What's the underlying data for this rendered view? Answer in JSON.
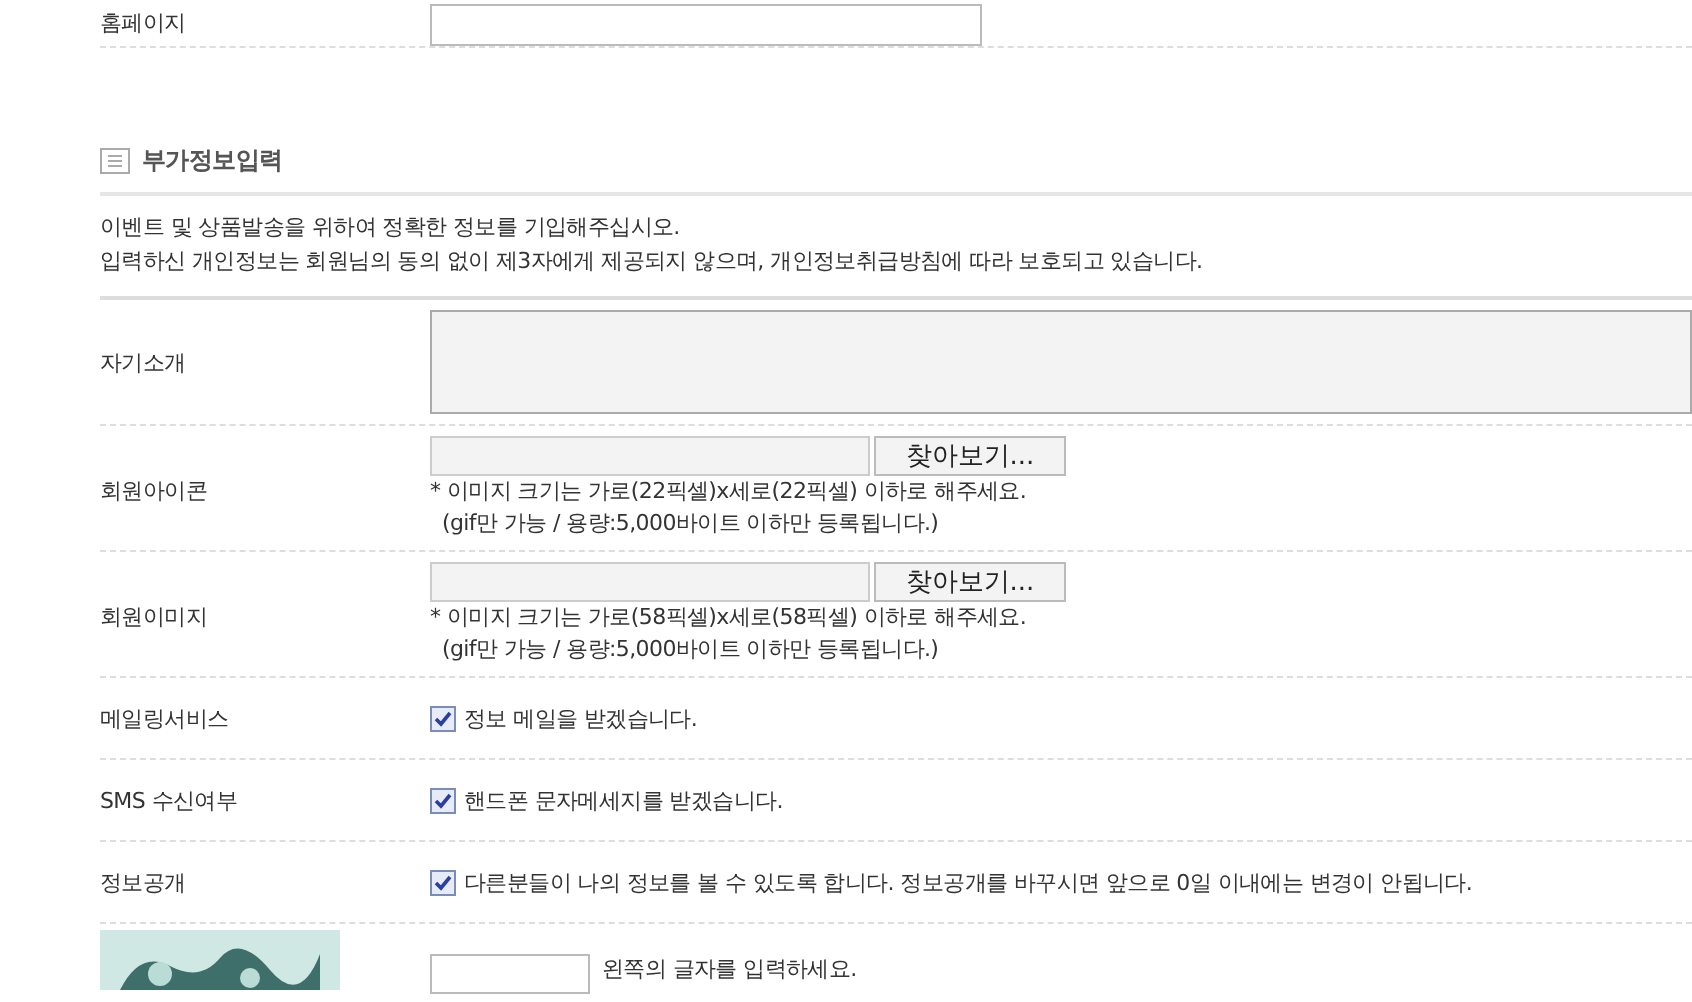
{
  "top_row": {
    "label": "홈페이지"
  },
  "section": {
    "title": "부가정보입력",
    "intro": [
      "이벤트 및 상품발송을 위하여 정확한 정보를 기입해주십시오.",
      "입력하신 개인정보는 회원님의 동의 없이 제3자에게 제공되지 않으며, 개인정보취급방침에 따라 보호되고 있습니다."
    ]
  },
  "rows": [
    {
      "kind": "textarea",
      "label": "자기소개"
    },
    {
      "kind": "file",
      "label": "회원아이콘",
      "button": "찾아보기...",
      "notes": [
        "* 이미지 크기는 가로(22픽셀)x세로(22픽셀) 이하로 해주세요.",
        "(gif만 가능 / 용량:5,000바이트 이하만 등록됩니다.)"
      ]
    },
    {
      "kind": "file",
      "label": "회원이미지",
      "button": "찾아보기...",
      "notes": [
        "* 이미지 크기는 가로(58픽셀)x세로(58픽셀) 이하로 해주세요.",
        "(gif만 가능 / 용량:5,000바이트 이하만 등록됩니다.)"
      ]
    },
    {
      "kind": "checkbox",
      "label": "메일링서비스",
      "checked": true,
      "text": "정보 메일을 받겠습니다."
    },
    {
      "kind": "checkbox",
      "label": "SMS 수신여부",
      "checked": true,
      "text": "핸드폰 문자메세지를 받겠습니다."
    },
    {
      "kind": "checkbox",
      "label": "정보공개",
      "checked": true,
      "text": "다른분들이 나의 정보를 볼 수 있도록 합니다. 정보공개를 바꾸시면 앞으로 0일 이내에는 변경이 안됩니다."
    }
  ],
  "captcha": {
    "hint": "왼쪽의 글자를 입력하세요."
  }
}
